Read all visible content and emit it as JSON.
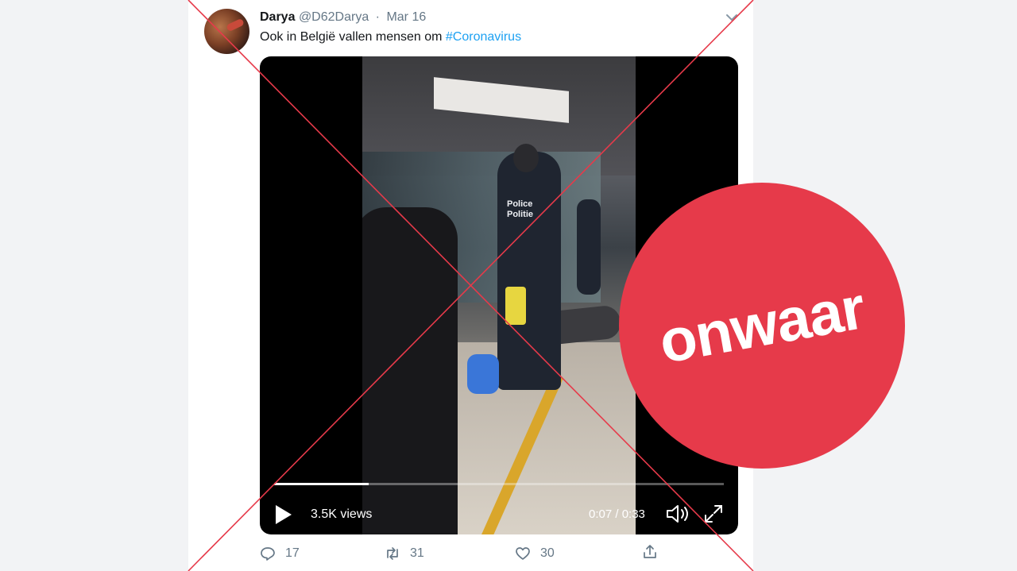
{
  "tweet": {
    "author_name": "Darya",
    "handle": "@D62Darya",
    "separator": "·",
    "date": "Mar 16",
    "text_prefix": "Ook in België vallen mensen om ",
    "hashtag": "#Coronavirus"
  },
  "video": {
    "overlay_text": [
      "Police",
      "Politie"
    ],
    "views": "3.5K views",
    "time": "0:07 / 0:33",
    "progress_fraction": 0.21
  },
  "actions": {
    "replies": "17",
    "retweets": "31",
    "likes": "30"
  },
  "stamp": {
    "label": "onwaar",
    "color": "#e63a4a"
  },
  "colors": {
    "hashtag": "#1da1f2",
    "cross_lines": "#e63a4a",
    "muted_text": "#657786"
  }
}
